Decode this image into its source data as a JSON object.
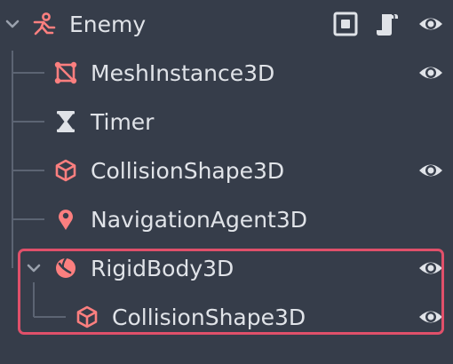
{
  "scene_tree": {
    "nodes": [
      {
        "label": "Enemy",
        "icon": "character-body-icon",
        "expanded": true,
        "depth": 0,
        "buttons": [
          "node-toggle-icon",
          "script-icon",
          "visibility-eye-icon"
        ]
      },
      {
        "label": "MeshInstance3D",
        "icon": "mesh-instance-icon",
        "depth": 1,
        "buttons": [
          "visibility-eye-icon"
        ]
      },
      {
        "label": "Timer",
        "icon": "hourglass-icon",
        "depth": 1,
        "buttons": []
      },
      {
        "label": "CollisionShape3D",
        "icon": "cube-icon",
        "depth": 1,
        "buttons": [
          "visibility-eye-icon"
        ]
      },
      {
        "label": "NavigationAgent3D",
        "icon": "map-pin-icon",
        "depth": 1,
        "buttons": []
      },
      {
        "label": "RigidBody3D",
        "icon": "ball-icon",
        "expanded": true,
        "depth": 1,
        "buttons": [
          "visibility-eye-icon"
        ]
      },
      {
        "label": "CollisionShape3D",
        "icon": "cube-icon",
        "depth": 2,
        "buttons": [
          "visibility-eye-icon"
        ]
      }
    ],
    "colors": {
      "background": "#363d4a",
      "text": "#e0e3e8",
      "node_icon": "#fc7f7f",
      "guide_lines": "#5c6473",
      "arrow": "#9aa1ad",
      "highlight_border": "#e0506a",
      "eye_icon": "#e0e3e8"
    }
  }
}
